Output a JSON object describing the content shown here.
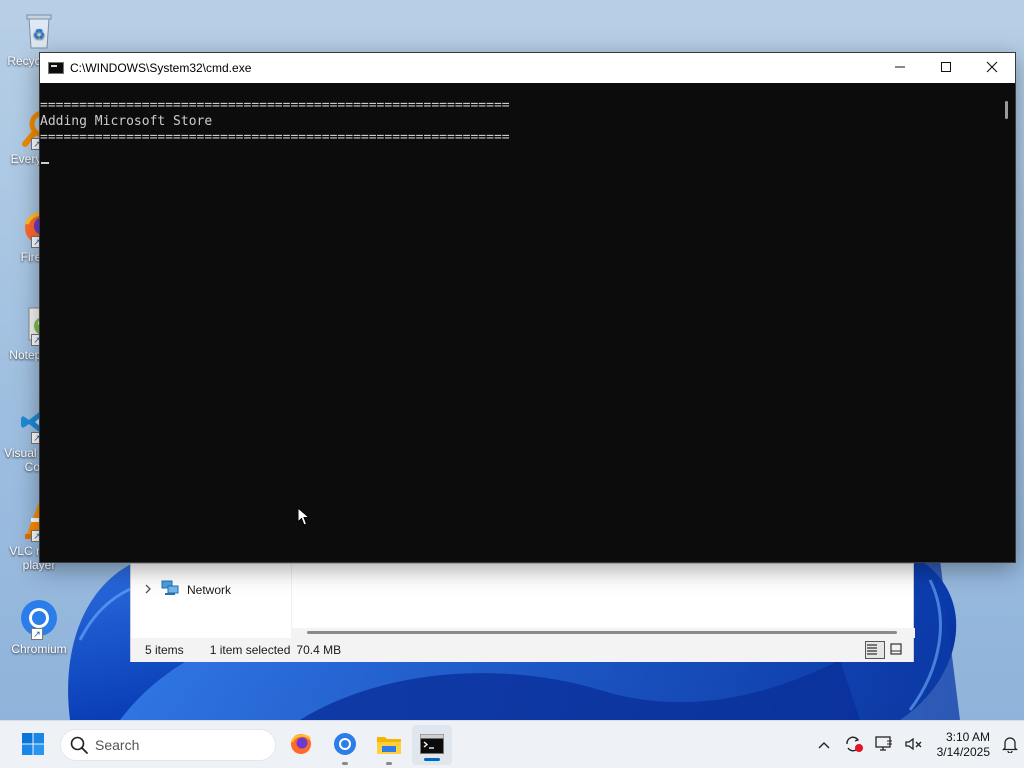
{
  "desktop": {
    "icons": [
      {
        "label": "Recycle Bin",
        "icon": "recycle-bin-icon"
      },
      {
        "label": "Everything",
        "icon": "everything-search-icon"
      },
      {
        "label": "Firefox",
        "icon": "firefox-icon"
      },
      {
        "label": "Notepad++",
        "icon": "notepad-plus-plus-icon"
      },
      {
        "label": "Visual Studio Code",
        "icon": "vscode-icon"
      },
      {
        "label": "VLC media player",
        "icon": "vlc-icon"
      },
      {
        "label": "Chromium",
        "icon": "chromium-icon"
      }
    ]
  },
  "cmd_window": {
    "title": "C:\\WINDOWS\\System32\\cmd.exe",
    "lines": [
      "============================================================",
      "Adding Microsoft Store",
      "============================================================"
    ]
  },
  "explorer_window": {
    "nav_item": "Network",
    "status": {
      "items_count": "5 items",
      "selection": "1 item selected",
      "size": "70.4 MB"
    }
  },
  "taskbar": {
    "search_placeholder": "Search",
    "pinned": [
      {
        "name": "Firefox",
        "icon": "firefox-icon"
      },
      {
        "name": "Chromium",
        "icon": "chromium-icon"
      },
      {
        "name": "File Explorer",
        "icon": "file-explorer-icon"
      },
      {
        "name": "Command Prompt",
        "icon": "cmd-icon"
      }
    ],
    "time": "3:10 AM",
    "date": "3/14/2025"
  },
  "colors": {
    "accent": "#0067c0",
    "console_bg": "#0c0c0c",
    "console_fg": "#cccccc"
  }
}
